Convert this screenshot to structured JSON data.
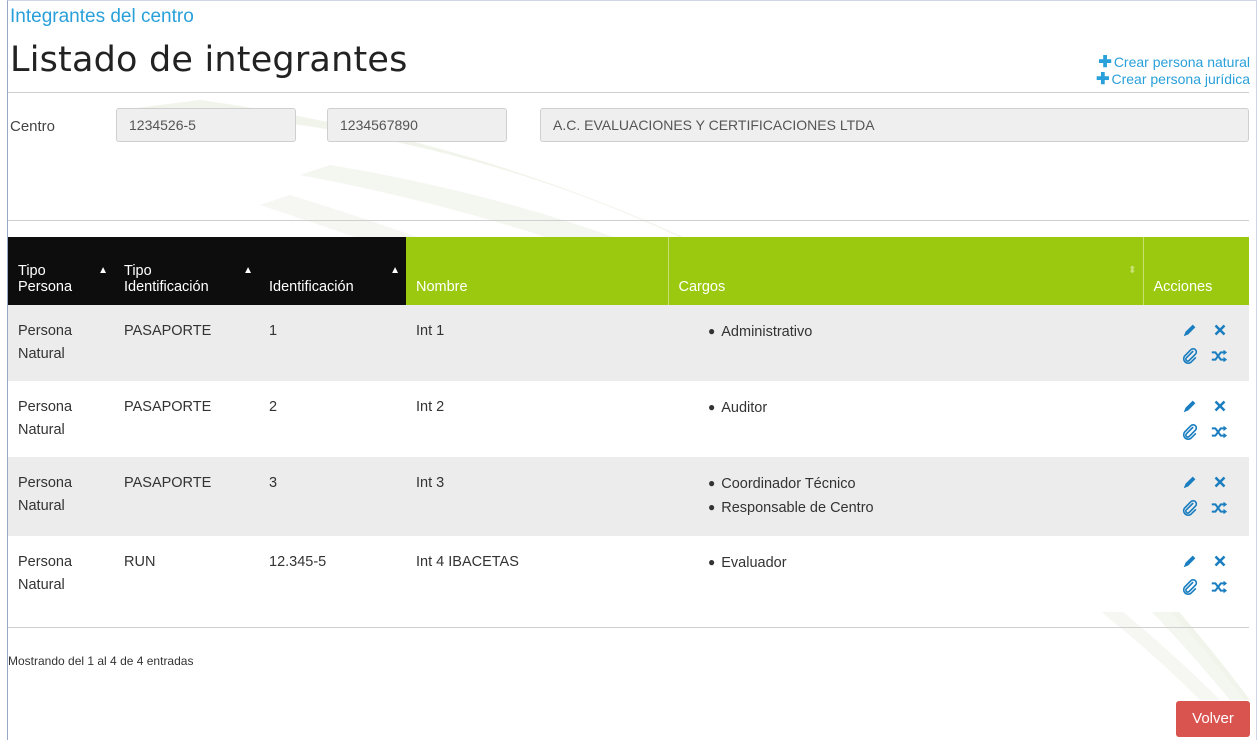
{
  "breadcrumb": "Integrantes del centro",
  "page_title": "Listado de integrantes",
  "top_actions": [
    {
      "label": "Crear persona natural",
      "icon": "plus-icon"
    },
    {
      "label": "Crear persona jurídica",
      "icon": "plus-icon"
    }
  ],
  "centro": {
    "label": "Centro",
    "field1": "1234526-5",
    "field2": "1234567890",
    "field3": "A.C. EVALUACIONES Y CERTIFICACIONES LTDA"
  },
  "table": {
    "headers": {
      "tipo_persona": [
        "Tipo",
        "Persona"
      ],
      "tipo_identificacion": [
        "Tipo",
        "Identificación"
      ],
      "identificacion": "Identificación",
      "nombre": "Nombre",
      "cargos": "Cargos",
      "acciones": "Acciones"
    },
    "rows": [
      {
        "tipo_persona": [
          "Persona",
          "Natural"
        ],
        "tipo_id": "PASAPORTE",
        "identificacion": "1",
        "nombre": "Int 1",
        "cargos": [
          "Administrativo"
        ]
      },
      {
        "tipo_persona": [
          "Persona",
          "Natural"
        ],
        "tipo_id": "PASAPORTE",
        "identificacion": "2",
        "nombre": "Int 2",
        "cargos": [
          "Auditor"
        ]
      },
      {
        "tipo_persona": [
          "Persona",
          "Natural"
        ],
        "tipo_id": "PASAPORTE",
        "identificacion": "3",
        "nombre": "Int 3",
        "cargos": [
          "Coordinador Técnico",
          "Responsable de Centro"
        ]
      },
      {
        "tipo_persona": [
          "Persona",
          "Natural"
        ],
        "tipo_id": "RUN",
        "identificacion": "12.345-5",
        "nombre": "Int 4 IBACETAS",
        "cargos": [
          "Evaluador"
        ]
      }
    ],
    "row_actions": [
      "edit-icon",
      "delete-icon",
      "attach-icon",
      "shuffle-icon"
    ]
  },
  "footer_info": "Mostrando del 1 al 4 de 4 entradas",
  "volver_label": "Volver",
  "colors": {
    "accent": "#29a0da",
    "header_dark": "#0d0d0d",
    "header_green": "#9bc90f",
    "danger": "#d9534f"
  }
}
